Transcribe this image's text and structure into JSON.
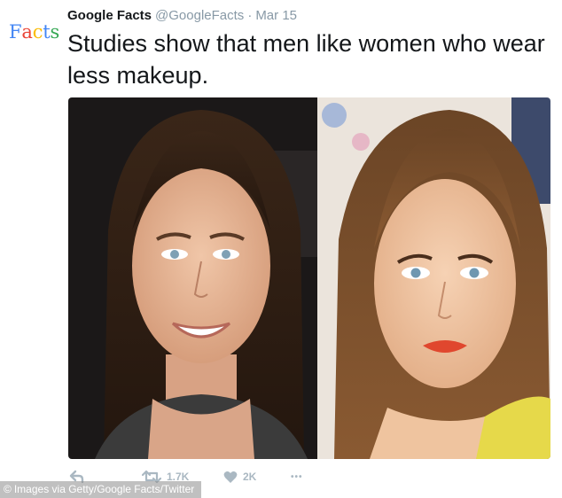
{
  "avatar": {
    "text": "Facts",
    "letters": [
      "F",
      "a",
      "c",
      "t",
      "s"
    ],
    "letter_colors": [
      "#4285f4",
      "#ea4335",
      "#fbbc05",
      "#4285f4",
      "#34a853"
    ]
  },
  "tweet": {
    "author_name": "Google Facts",
    "handle": "@GoogleFacts",
    "separator": "·",
    "date": "Mar 15",
    "text": "Studies show that men like women who wear less makeup."
  },
  "media": {
    "panels": [
      "no-makeup-photo",
      "makeup-photo"
    ]
  },
  "actions": {
    "reply": {
      "icon": "reply-icon",
      "count": ""
    },
    "retweet": {
      "icon": "retweet-icon",
      "count": "1.7K"
    },
    "like": {
      "icon": "heart-icon",
      "count": "2K"
    },
    "more": {
      "icon": "more-icon",
      "label": "•••"
    }
  },
  "credit": {
    "symbol": "©",
    "text": "Images via Getty/Google Facts/Twitter"
  },
  "colors": {
    "muted": "#8899a6",
    "action_gray": "#aab8c2",
    "text": "#14171a"
  }
}
